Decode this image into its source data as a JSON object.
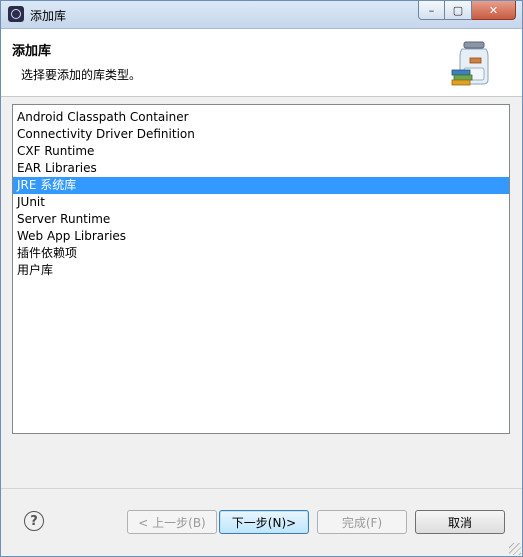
{
  "window": {
    "title": "添加库",
    "controls": {
      "minimize": "–",
      "maximize": "▢",
      "close": "✕"
    }
  },
  "banner": {
    "title": "添加库",
    "description": "选择要添加的库类型。",
    "icon": "library-jar-icon"
  },
  "library_types": [
    {
      "label": "Android Classpath Container",
      "selected": false
    },
    {
      "label": "Connectivity Driver Definition",
      "selected": false
    },
    {
      "label": "CXF Runtime",
      "selected": false
    },
    {
      "label": "EAR Libraries",
      "selected": false
    },
    {
      "label": "JRE 系统库",
      "selected": true
    },
    {
      "label": "JUnit",
      "selected": false
    },
    {
      "label": "Server Runtime",
      "selected": false
    },
    {
      "label": "Web App Libraries",
      "selected": false
    },
    {
      "label": "插件依赖项",
      "selected": false
    },
    {
      "label": "用户库",
      "selected": false
    }
  ],
  "footer": {
    "help_icon": "help-icon",
    "help_glyph": "?",
    "back_label": "< 上一步(B)",
    "next_label": "下一步(N)>",
    "finish_label": "完成(F)",
    "cancel_label": "取消"
  },
  "colors": {
    "selection": "#3399ff",
    "titlebar": "#c6d7ec",
    "close_button": "#c85a40"
  }
}
